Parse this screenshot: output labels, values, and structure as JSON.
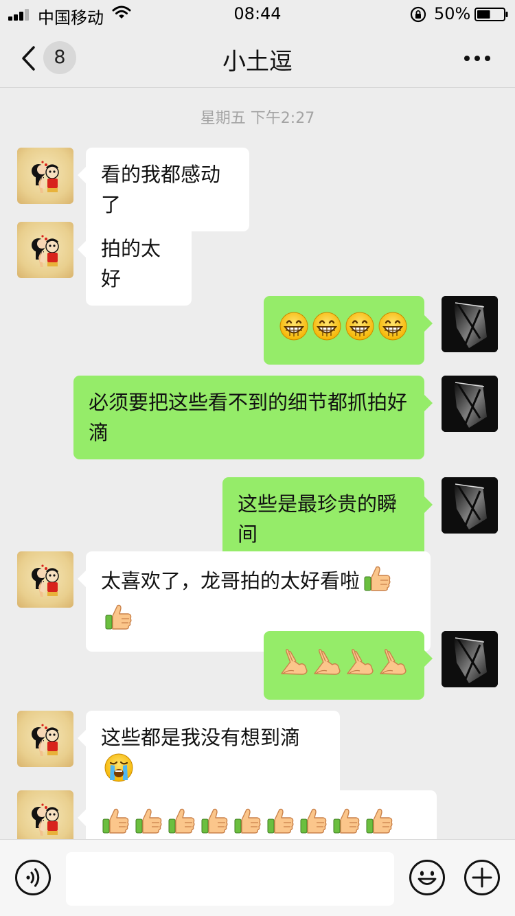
{
  "status_bar": {
    "carrier": "中国移动",
    "time": "08:44",
    "battery_percent": "50%",
    "battery_level": 0.5,
    "icons": [
      "signal-icon",
      "wifi-icon",
      "orientation-lock-icon",
      "battery-icon"
    ]
  },
  "nav": {
    "unread_count": "8",
    "title": "小土逗",
    "icons": [
      "back-chevron-icon",
      "more-icon"
    ]
  },
  "chat": {
    "timestamp": "星期五 下午2:27",
    "messages": [
      {
        "sender": "friend",
        "text": "看的我都感动了",
        "emoji": []
      },
      {
        "sender": "friend",
        "text": "拍的太好",
        "emoji": []
      },
      {
        "sender": "me",
        "text": "",
        "emoji": [
          "grin",
          "grin",
          "grin",
          "grin"
        ]
      },
      {
        "sender": "me",
        "text": "必须要把这些看不到的细节都抓拍好滴",
        "emoji": []
      },
      {
        "sender": "me",
        "text": "这些是最珍贵的瞬间",
        "emoji": []
      },
      {
        "sender": "friend",
        "text": "太喜欢了，龙哥拍的太好看啦",
        "emoji": [
          "thumbs-up",
          "thumbs-up"
        ]
      },
      {
        "sender": "me",
        "text": "",
        "emoji": [
          "ok-hand",
          "ok-hand",
          "ok-hand",
          "ok-hand"
        ]
      },
      {
        "sender": "friend",
        "text": "这些都是我没有想到滴",
        "emoji": [
          "crying"
        ]
      },
      {
        "sender": "friend",
        "text": "",
        "emoji": [
          "thumbs-up",
          "thumbs-up",
          "thumbs-up",
          "thumbs-up",
          "thumbs-up",
          "thumbs-up",
          "thumbs-up",
          "thumbs-up",
          "thumbs-up"
        ]
      }
    ]
  },
  "input_bar": {
    "value": "",
    "icons": [
      "voice-icon",
      "emoji-icon",
      "plus-icon"
    ]
  },
  "colors": {
    "background": "#ededed",
    "bubble_incoming": "#ffffff",
    "bubble_outgoing": "#95ec69",
    "timestamp": "#a3a3a3"
  }
}
